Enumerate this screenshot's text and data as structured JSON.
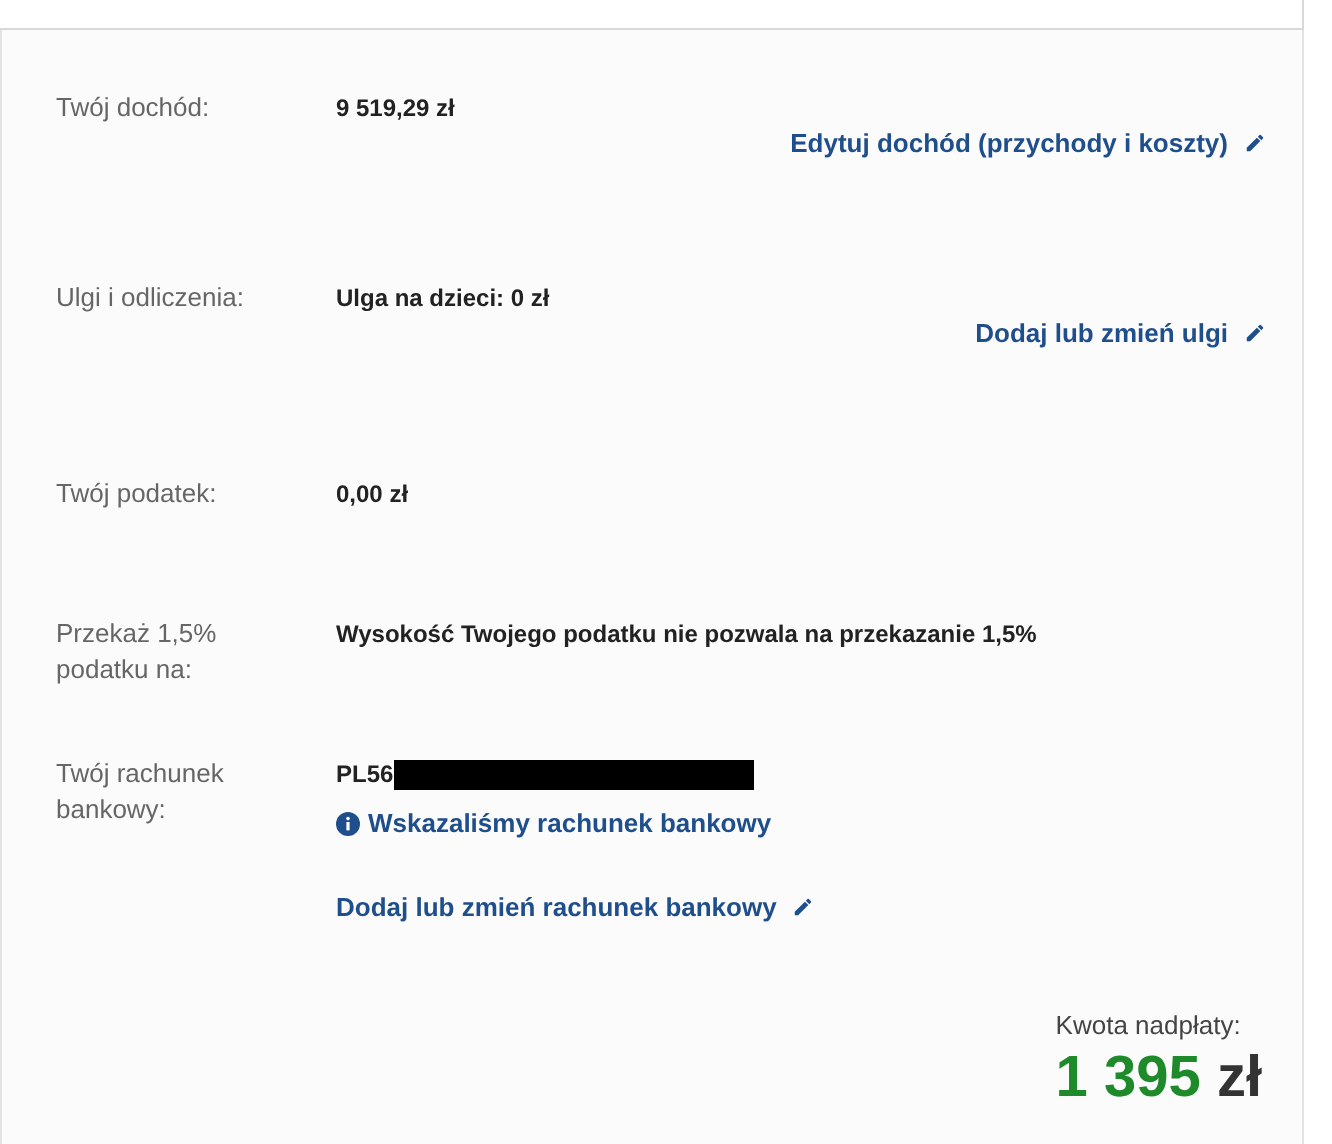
{
  "rows": [
    {
      "label": "Twój dochód:",
      "value": "9 519,29 zł",
      "link": "Edytuj dochód (przychody i koszty)"
    },
    {
      "label": "Ulgi i odliczenia:",
      "value": "Ulga na dzieci: 0 zł",
      "link": "Dodaj lub zmień ulgi"
    },
    {
      "label": "Twój podatek:",
      "value": "0,00 zł"
    },
    {
      "label": "Przekaż 1,5% podatku na:",
      "value": "Wysokość Twojego podatku nie pozwala na przekazanie 1,5%"
    }
  ],
  "bank": {
    "label": "Twój rachunek bankowy:",
    "value": "PL56",
    "redacted": true,
    "info": "Wskazaliśmy rachunek bankowy",
    "link": "Dodaj lub zmień rachunek bankowy"
  },
  "overpayment": {
    "label": "Kwota nadpłaty:",
    "amount": "1 395",
    "currency": "zł"
  }
}
